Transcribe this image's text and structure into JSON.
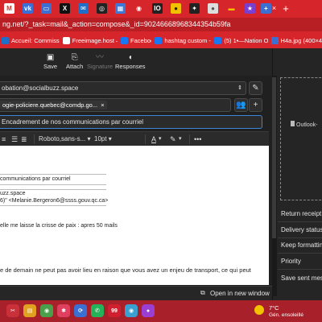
{
  "browser": {
    "tabs": [
      {
        "icon": "gmail-icon",
        "color": "#ffffff",
        "glyph": "M",
        "fg": "#d93025"
      },
      {
        "icon": "vk-icon",
        "color": "#3a6fd8",
        "glyph": "vk",
        "fg": "#ffffff"
      },
      {
        "icon": "webmail-icon",
        "color": "#3b6fd1",
        "glyph": "▭",
        "fg": "#ffffff"
      },
      {
        "icon": "x-icon",
        "color": "#111111",
        "glyph": "X",
        "fg": "#ffffff"
      },
      {
        "icon": "email-icon",
        "color": "#1f6fc8",
        "glyph": "✉",
        "fg": "#ffffff"
      },
      {
        "icon": "chatgpt-icon",
        "color": "#222222",
        "glyph": "◎",
        "fg": "#ffffff"
      },
      {
        "icon": "windows-icon",
        "color": "#3c78d8",
        "glyph": "▦",
        "fg": "#ffffff"
      },
      {
        "icon": "radio-canada-icon",
        "color": "#d6262c",
        "glyph": "◉",
        "fg": "#ffffff"
      },
      {
        "icon": "io-icon",
        "color": "#222222",
        "glyph": "IO",
        "fg": "#ffffff"
      },
      {
        "icon": "yellow-icon",
        "color": "#f2c200",
        "glyph": "●",
        "fg": "#222222"
      },
      {
        "icon": "dark-icon",
        "color": "#222222",
        "glyph": "✦",
        "fg": "#ffffff"
      },
      {
        "icon": "globe-icon",
        "color": "#dddddd",
        "glyph": "●",
        "fg": "#555555"
      },
      {
        "icon": "flag-icon",
        "color": "#d6262c",
        "glyph": "▬",
        "fg": "#f2c200"
      },
      {
        "icon": "star-icon",
        "color": "#7a3fd1",
        "glyph": "★",
        "fg": "#ffffff"
      },
      {
        "icon": "plus-tab-icon",
        "color": "#3b6fd1",
        "glyph": "+",
        "fg": "#ffffff"
      }
    ],
    "tab_close": "×",
    "new_tab": "+",
    "url": "ng.net/?_task=mail&_action=compose&_id=90246668968344354b59fa",
    "bookmarks": [
      {
        "label": "Accueil: Commissaire",
        "color": "#1f6fc8"
      },
      {
        "label": "Freeimage.host —...",
        "color": "#ffffff"
      },
      {
        "label": "Facebook",
        "color": "#1877f2"
      },
      {
        "label": "hashtag custom - P...",
        "color": "#1877f2"
      },
      {
        "label": "(5) 1•—Nation On...",
        "color": "#1877f2"
      },
      {
        "label": "H4a.jpg (400×400)",
        "color": "#3b6fd1"
      }
    ]
  },
  "toolbar": {
    "save": "Save",
    "attach": "Attach",
    "signature": "Signature",
    "responses": "Responses"
  },
  "compose": {
    "from": "obation@socialbuzz.space",
    "to_chip": "ogie-policiere.quebec@comdp.go...",
    "to_chip_close": "×",
    "subject": "Encadrement de nos communications par courriel"
  },
  "editor_toolbar": {
    "font": "Roboto,sans-s...",
    "size": "10pt",
    "more": "•••"
  },
  "body": {
    "quoted_subject": "communications par courriel",
    "quoted_from": "uzz.space",
    "quoted_to": "6)\" <Melanie.Bergeron6@ssss.gouv.qc.ca>",
    "line1": "elle me laisse la crisse de paix : apres 50 mails",
    "line2": "e de demain ne peut pas avoir lieu en raison que vous avez un enjeu de transport, ce qui peut"
  },
  "popout": "Open in new window",
  "right_panel": {
    "attachment": "Outlook-",
    "options": [
      "Return receipt",
      "Delivery status n",
      "Keep formatting",
      "Priority",
      "Save sent mess"
    ]
  },
  "taskbar": {
    "weather_temp": "7°C",
    "weather_text": "Gén. ensoleillé",
    "apps": [
      {
        "icon": "scissors-icon",
        "color": "#c8303a",
        "glyph": "✂"
      },
      {
        "icon": "files-icon",
        "color": "#e0a020",
        "glyph": "▤"
      },
      {
        "icon": "chrome-icon",
        "color": "#4aa04a",
        "glyph": "◉"
      },
      {
        "icon": "spark-icon",
        "color": "#e04060",
        "glyph": "✱"
      },
      {
        "icon": "sync-icon",
        "color": "#3b6fd1",
        "glyph": "⟳"
      },
      {
        "icon": "whatsapp-icon",
        "color": "#25b35a",
        "glyph": "✆"
      },
      {
        "icon": "notification-icon",
        "color": "#d02030",
        "glyph": "99"
      },
      {
        "icon": "chrome-alt-icon",
        "color": "#3aa0d0",
        "glyph": "◉"
      },
      {
        "icon": "purple-icon",
        "color": "#9a3fd1",
        "glyph": "●"
      }
    ]
  },
  "colors": {
    "accent": "#d6262c",
    "focus": "#3a87d6"
  }
}
